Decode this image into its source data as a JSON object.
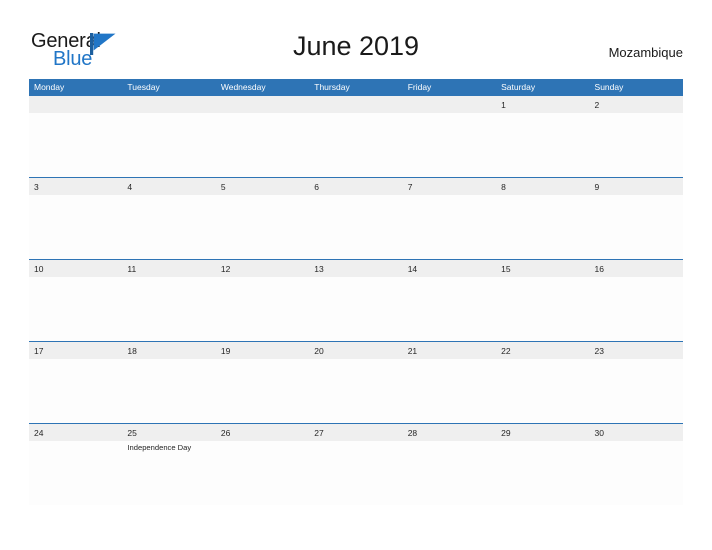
{
  "brand": {
    "name_part1": "General",
    "name_part2": "Blue",
    "mark": "flag-triangle-icon",
    "accent_color": "#2176c7"
  },
  "header": {
    "title": "June 2019",
    "country": "Mozambique"
  },
  "theme": {
    "header_blue": "#2e74b5",
    "date_strip_gray": "#efefef",
    "text_dark": "#262626",
    "page_background": "#ffffff"
  },
  "calendar": {
    "month": "June",
    "year": "2019",
    "day_headers": [
      "Monday",
      "Tuesday",
      "Wednesday",
      "Thursday",
      "Friday",
      "Saturday",
      "Sunday"
    ],
    "weeks": [
      {
        "dates": [
          "",
          "",
          "",
          "",
          "",
          "1",
          "2"
        ],
        "events": [
          "",
          "",
          "",
          "",
          "",
          "",
          ""
        ]
      },
      {
        "dates": [
          "3",
          "4",
          "5",
          "6",
          "7",
          "8",
          "9"
        ],
        "events": [
          "",
          "",
          "",
          "",
          "",
          "",
          ""
        ]
      },
      {
        "dates": [
          "10",
          "11",
          "12",
          "13",
          "14",
          "15",
          "16"
        ],
        "events": [
          "",
          "",
          "",
          "",
          "",
          "",
          ""
        ]
      },
      {
        "dates": [
          "17",
          "18",
          "19",
          "20",
          "21",
          "22",
          "23"
        ],
        "events": [
          "",
          "",
          "",
          "",
          "",
          "",
          ""
        ]
      },
      {
        "dates": [
          "24",
          "25",
          "26",
          "27",
          "28",
          "29",
          "30"
        ],
        "events": [
          "",
          "Independence Day",
          "",
          "",
          "",
          "",
          ""
        ]
      }
    ]
  }
}
